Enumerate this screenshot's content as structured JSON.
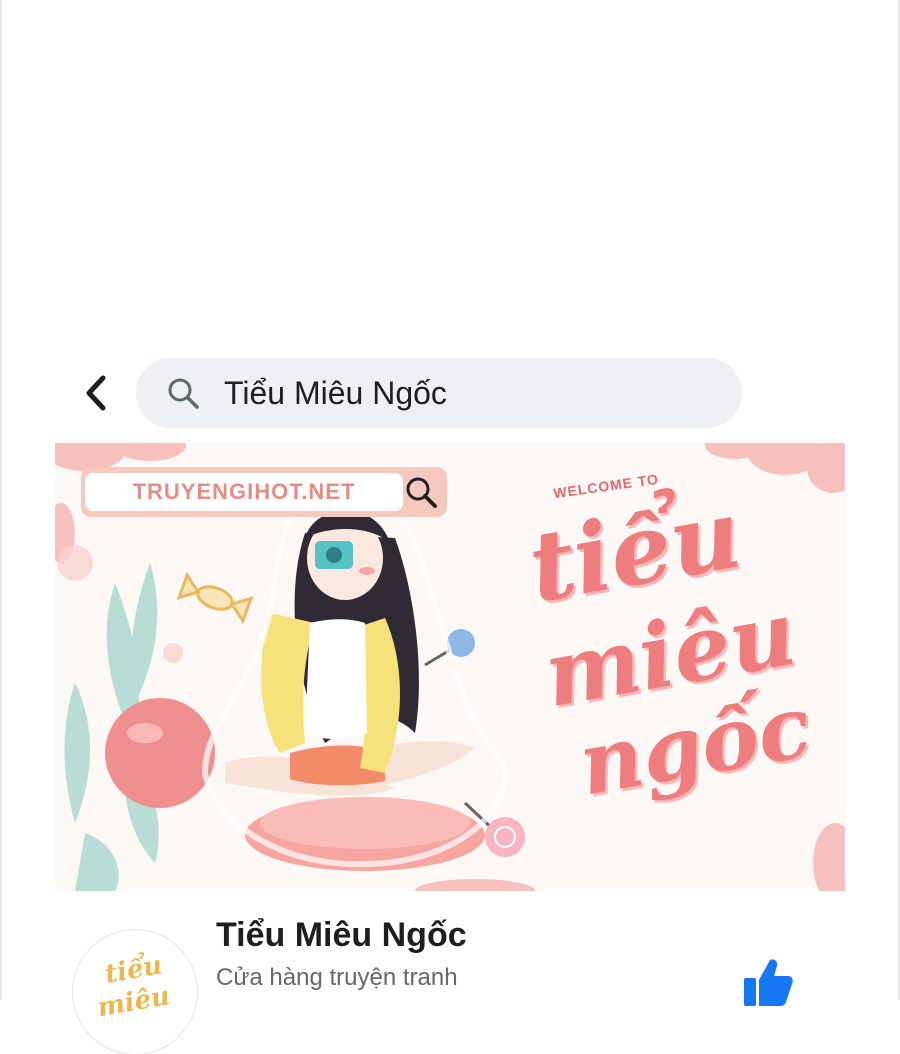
{
  "search": {
    "query": "Tiểu Miêu Ngốc"
  },
  "cover": {
    "site_label": "TRUYENGIHOT.NET",
    "welcome": "WELCOME TO",
    "script_line1": "tiểu",
    "script_line2": "miêu",
    "script_line3": "ngốc"
  },
  "profile": {
    "name": "Tiểu Miêu Ngốc",
    "category": "Cửa hàng truyện tranh",
    "avatar_text": "tiểu miêu"
  },
  "colors": {
    "search_bg": "#eef0f3",
    "accent_pink": "#ee7d80",
    "like_blue": "#1877f2"
  },
  "icons": {
    "back": "chevron-left-icon",
    "search": "search-icon",
    "like": "thumbs-up-icon"
  }
}
